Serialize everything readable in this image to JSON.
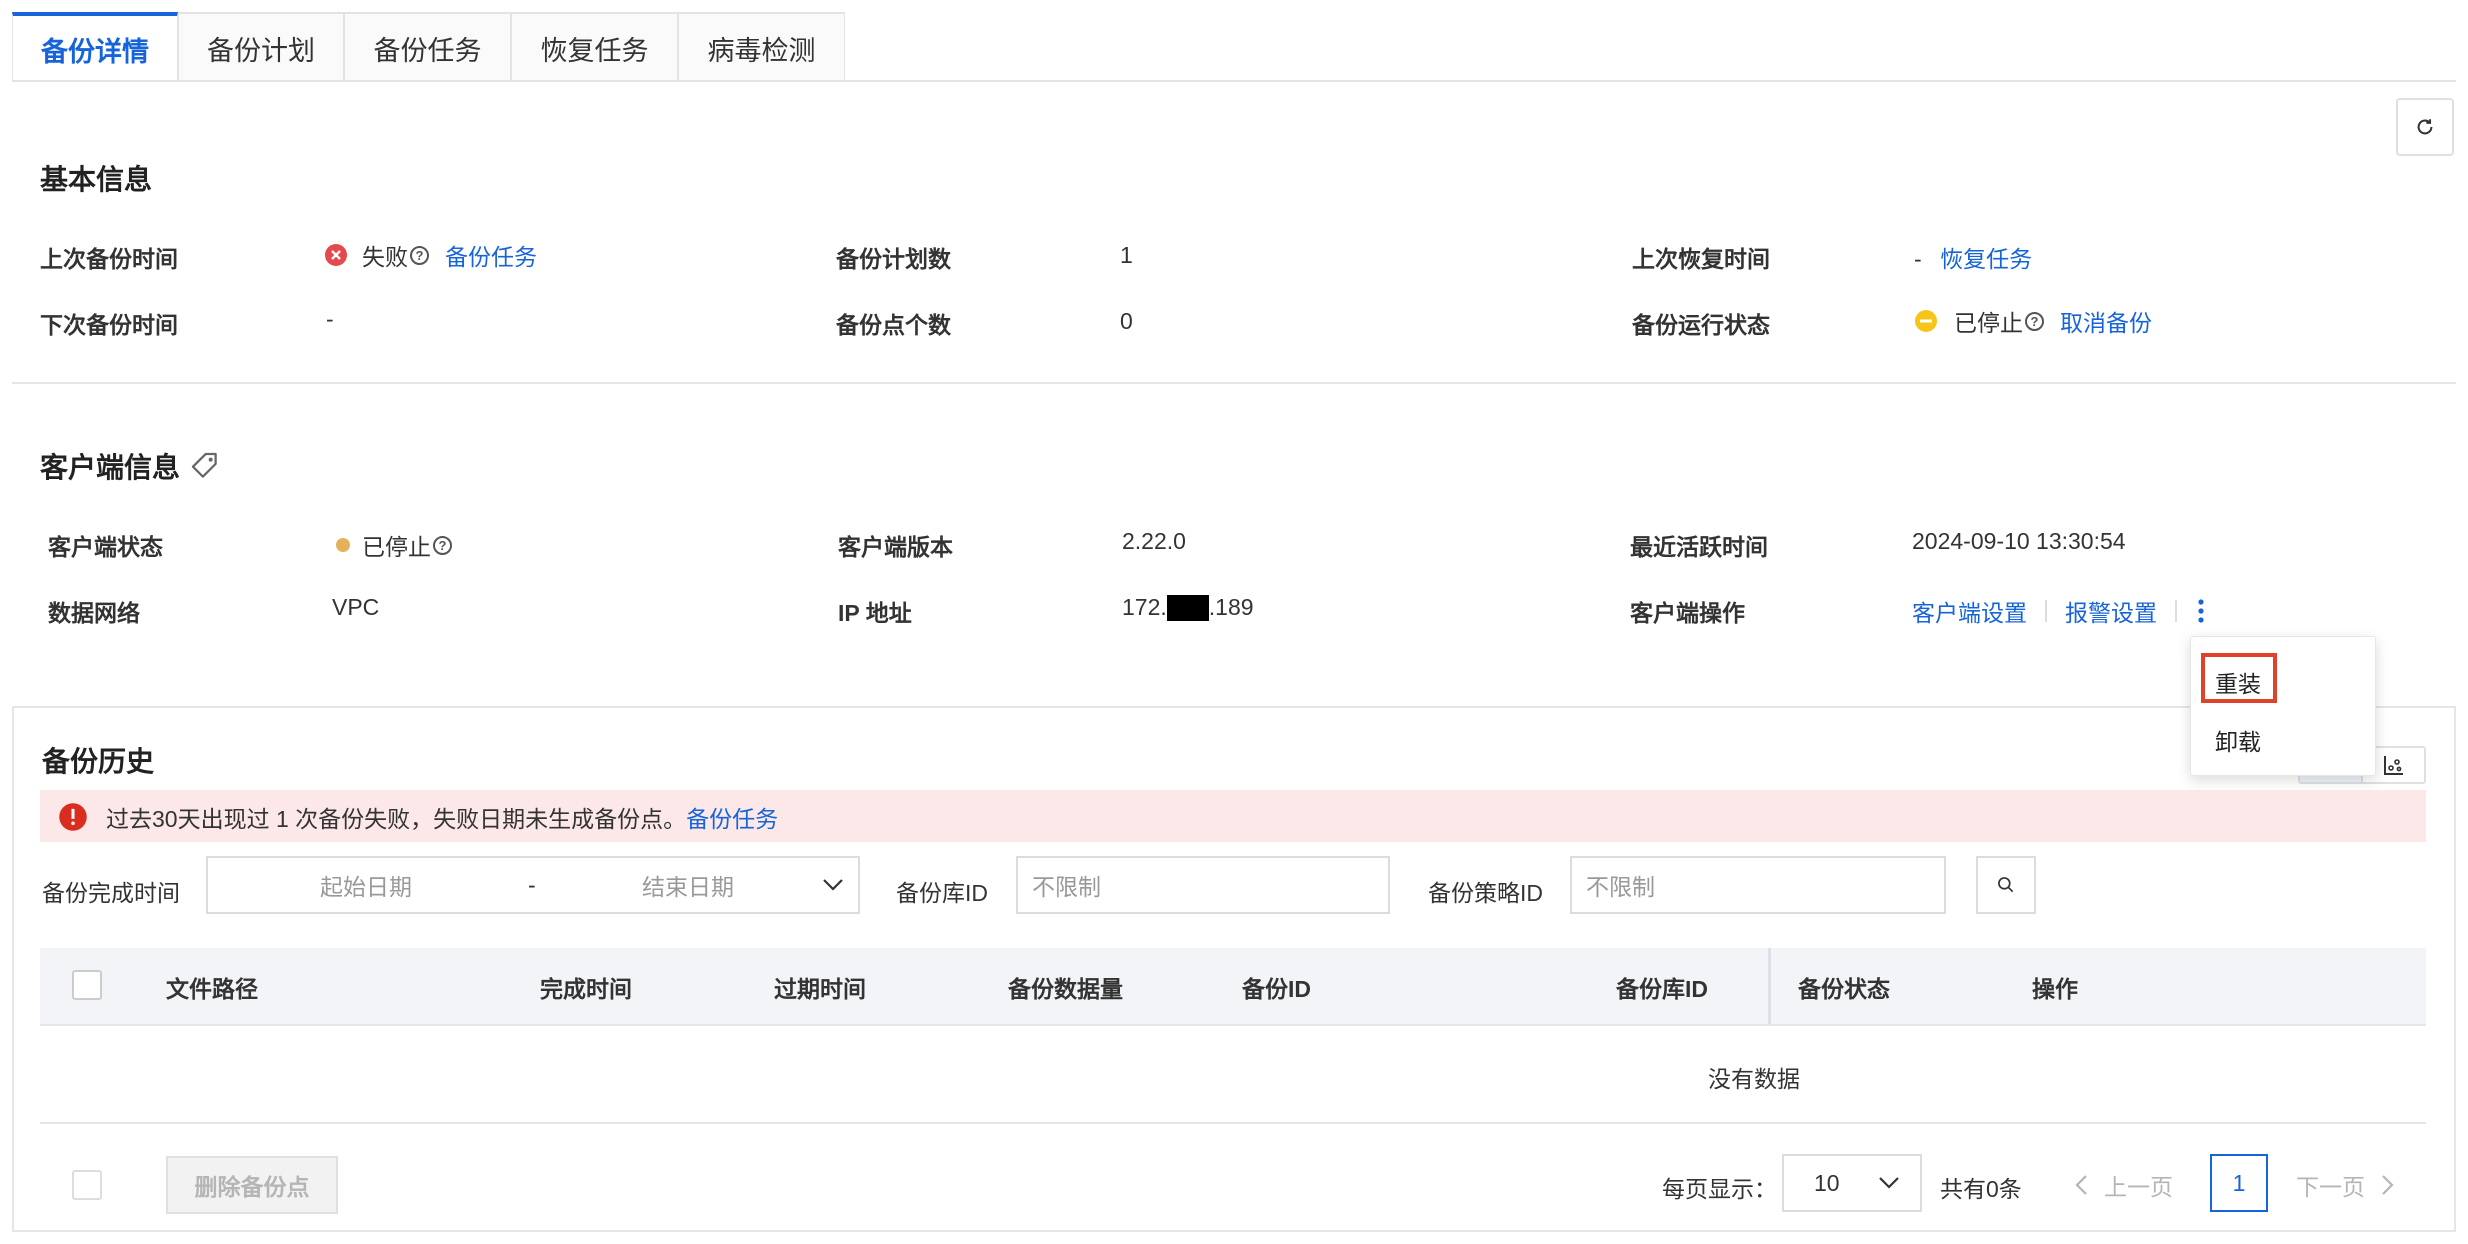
{
  "tabs": [
    "备份详情",
    "备份计划",
    "备份任务",
    "恢复任务",
    "病毒检测"
  ],
  "basic": {
    "title": "基本信息",
    "last_backup_label": "上次备份时间",
    "last_backup_status": "失败",
    "last_backup_link": "备份任务",
    "next_backup_label": "下次备份时间",
    "next_backup_value": "-",
    "plan_count_label": "备份计划数",
    "plan_count_value": "1",
    "point_count_label": "备份点个数",
    "point_count_value": "0",
    "last_restore_label": "上次恢复时间",
    "last_restore_value": "-",
    "last_restore_link": "恢复任务",
    "run_status_label": "备份运行状态",
    "run_status_value": "已停止",
    "cancel_link": "取消备份"
  },
  "client": {
    "title": "客户端信息",
    "status_label": "客户端状态",
    "status_value": "已停止",
    "network_label": "数据网络",
    "network_value": "VPC",
    "version_label": "客户端版本",
    "version_value": "2.22.0",
    "ip_label": "IP 地址",
    "ip_prefix": "172.",
    "ip_suffix": ".189",
    "active_label": "最近活跃时间",
    "active_value": "2024-09-10 13:30:54",
    "ops_label": "客户端操作",
    "ops_settings": "客户端设置",
    "ops_alarm": "报警设置"
  },
  "dropdown": {
    "reinstall": "重装",
    "uninstall": "卸载"
  },
  "history": {
    "title": "备份历史",
    "alert_text": "过去30天出现过 1 次备份失败，失败日期未生成备份点。",
    "alert_link": "备份任务",
    "finish_time_label": "备份完成时间",
    "start_placeholder": "起始日期",
    "date_sep": "-",
    "end_placeholder": "结束日期",
    "vault_label": "备份库ID",
    "vault_placeholder": "不限制",
    "policy_label": "备份策略ID",
    "policy_placeholder": "不限制",
    "columns": [
      "文件路径",
      "完成时间",
      "过期时间",
      "备份数据量",
      "备份ID",
      "备份库ID",
      "备份状态",
      "操作"
    ],
    "empty_text": "没有数据",
    "delete_button": "删除备份点",
    "page_size_label": "每页显示：",
    "page_size_value": "10",
    "total_text": "共有0条",
    "prev_label": "上一页",
    "current_page": "1",
    "next_label": "下一页"
  },
  "colors": {
    "accent": "#1664d9",
    "error": "#e5484d",
    "warning": "#f5c518",
    "stopped": "#e3b25a",
    "alert_bg": "#fce8e8",
    "highlight_box": "#e0412a"
  }
}
